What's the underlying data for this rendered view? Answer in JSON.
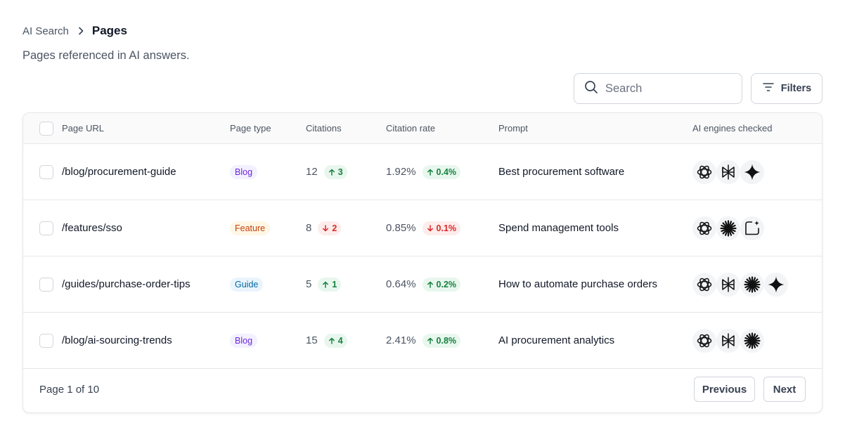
{
  "breadcrumb": {
    "root": "AI Search",
    "current": "Pages"
  },
  "subtitle": "Pages referenced in AI answers.",
  "search": {
    "placeholder": "Search",
    "value": ""
  },
  "filters_label": "Filters",
  "columns": {
    "url": "Page URL",
    "type": "Page type",
    "citations": "Citations",
    "rate": "Citation rate",
    "prompt": "Prompt",
    "engines": "AI engines checked"
  },
  "rows": [
    {
      "url": "/blog/procurement-guide",
      "type": "Blog",
      "citations": "12",
      "citations_delta": "3",
      "citations_dir": "up",
      "rate": "1.92%",
      "rate_delta": "0.4%",
      "rate_dir": "up",
      "prompt": "Best procurement software",
      "engines": [
        "openai-icon",
        "perplexity-icon",
        "gemini-icon"
      ]
    },
    {
      "url": "/features/sso",
      "type": "Feature",
      "citations": "8",
      "citations_delta": "2",
      "citations_dir": "down",
      "rate": "0.85%",
      "rate_delta": "0.1%",
      "rate_dir": "down",
      "prompt": "Spend management tools",
      "engines": [
        "openai-icon",
        "claude-icon",
        "copilot-icon"
      ]
    },
    {
      "url": "/guides/purchase-order-tips",
      "type": "Guide",
      "citations": "5",
      "citations_delta": "1",
      "citations_dir": "up",
      "rate": "0.64%",
      "rate_delta": "0.2%",
      "rate_dir": "up",
      "prompt": "How to automate purchase orders",
      "engines": [
        "openai-icon",
        "perplexity-icon",
        "claude-icon",
        "gemini-icon"
      ]
    },
    {
      "url": "/blog/ai-sourcing-trends",
      "type": "Blog",
      "citations": "15",
      "citations_delta": "4",
      "citations_dir": "up",
      "rate": "2.41%",
      "rate_delta": "0.8%",
      "rate_dir": "up",
      "prompt": "AI procurement analytics",
      "engines": [
        "openai-icon",
        "perplexity-icon",
        "claude-icon"
      ]
    }
  ],
  "pagination": {
    "info": "Page 1 of 10",
    "prev": "Previous",
    "next": "Next"
  },
  "colors": {
    "up": "#15803d",
    "down": "#dc2626",
    "border": "#e5e7eb"
  }
}
